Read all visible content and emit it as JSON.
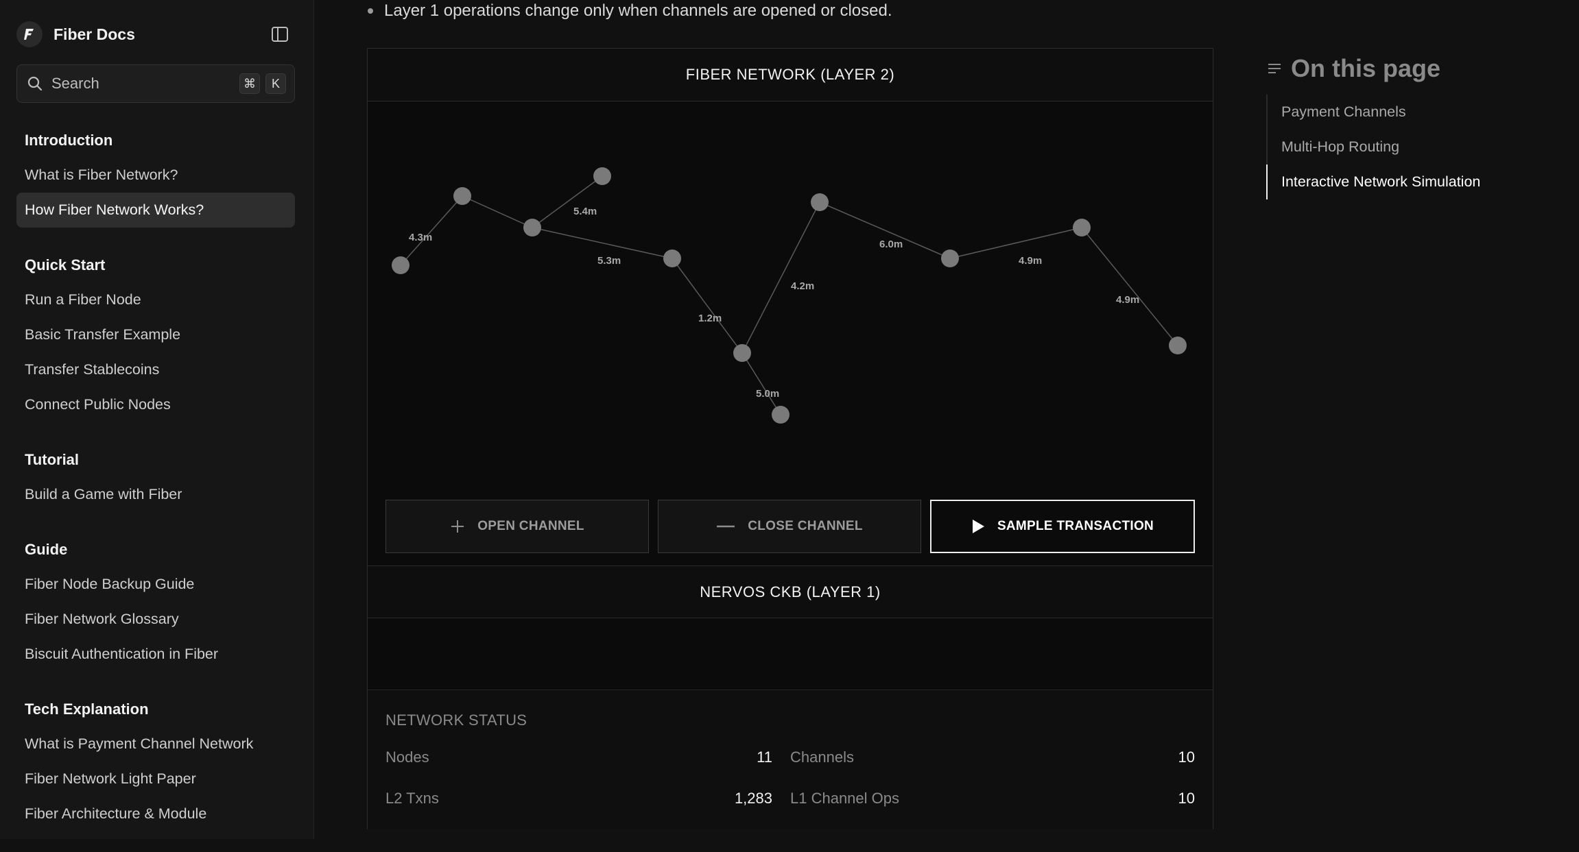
{
  "sidebar": {
    "brand": "Fiber Docs",
    "search": {
      "label": "Search",
      "shortcut_mod": "⌘",
      "shortcut_key": "K"
    },
    "sections": [
      {
        "heading": "Introduction",
        "items": [
          "What is Fiber Network?",
          "How Fiber Network Works?"
        ]
      },
      {
        "heading": "Quick Start",
        "items": [
          "Run a Fiber Node",
          "Basic Transfer Example",
          "Transfer Stablecoins",
          "Connect Public Nodes"
        ]
      },
      {
        "heading": "Tutorial",
        "items": [
          "Build a Game with Fiber"
        ]
      },
      {
        "heading": "Guide",
        "items": [
          "Fiber Node Backup Guide",
          "Fiber Network Glossary",
          "Biscuit Authentication in Fiber"
        ]
      },
      {
        "heading": "Tech Explanation",
        "items": [
          "What is Payment Channel Network",
          "Fiber Network Light Paper",
          "Fiber Architecture & Module"
        ]
      }
    ],
    "active_item": "How Fiber Network Works?"
  },
  "main": {
    "intro_line": "Layer 1 operations change only when channels are opened or closed.",
    "simulation": {
      "layer2_title": "FIBER NETWORK (LAYER 2)",
      "layer1_title": "NERVOS CKB (LAYER 1)",
      "graph": {
        "node_color": "#7a7a7a",
        "edge_color": "#5a5a5a",
        "edges": [
          {
            "label": "4.3m"
          },
          {
            "label": "5.4m"
          },
          {
            "label": "5.3m"
          },
          {
            "label": "1.2m"
          },
          {
            "label": "5.0m"
          },
          {
            "label": "4.2m"
          },
          {
            "label": "6.0m"
          },
          {
            "label": "4.9m"
          },
          {
            "label": "4.9m"
          }
        ]
      },
      "buttons": {
        "open_channel": "OPEN CHANNEL",
        "close_channel": "CLOSE CHANNEL",
        "sample_transaction": "SAMPLE TRANSACTION"
      },
      "status": {
        "title": "NETWORK STATUS",
        "nodes_label": "Nodes",
        "nodes_value": "11",
        "channels_label": "Channels",
        "channels_value": "10",
        "l2_txns_label": "L2 Txns",
        "l2_txns_value": "1,283",
        "l1_ops_label": "L1 Channel Ops",
        "l1_ops_value": "10"
      }
    }
  },
  "toc": {
    "title": "On this page",
    "items": [
      "Payment Channels",
      "Multi-Hop Routing",
      "Interactive Network Simulation"
    ],
    "active_item": "Interactive Network Simulation"
  }
}
